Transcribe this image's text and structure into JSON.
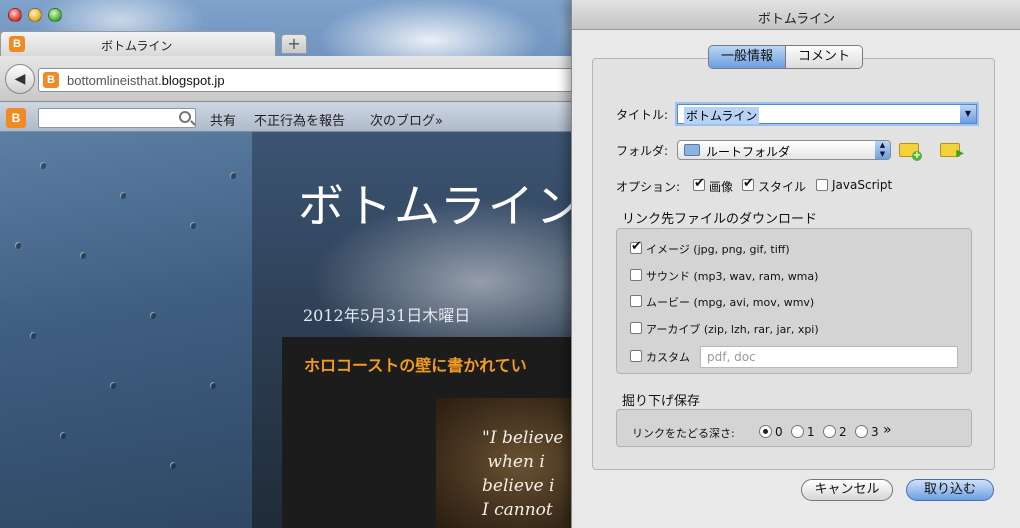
{
  "browser": {
    "tab_title": "ボトムライン",
    "new_tab_symbol": "+",
    "url_prefix": "bottomlineisthat.",
    "url_domain": "blogspot.jp",
    "blogger_letter": "B"
  },
  "blog_nav": {
    "share": "共有",
    "report": "不正行為を報告",
    "next_blog": "次のブログ»"
  },
  "blog": {
    "title": "ボトムライン",
    "date": "2012年5月31日木曜日",
    "post_title": "ホロコーストの壁に書かれてい",
    "quote": "\"I believe\n when i\nbelieve i\nI cannot"
  },
  "dialog": {
    "title": "ボトムライン",
    "tabs": [
      {
        "label": "一般情報",
        "active": true
      },
      {
        "label": "コメント",
        "active": false
      }
    ],
    "title_label": "タイトル:",
    "title_value": "ボトムライン",
    "folder_label": "フォルダ:",
    "folder_value": "ルートフォルダ",
    "options_label": "オプション:",
    "options": [
      {
        "label": "画像",
        "checked": true
      },
      {
        "label": "スタイル",
        "checked": true
      },
      {
        "label": "JavaScript",
        "checked": false
      }
    ],
    "download_heading": "リンク先ファイルのダウンロード",
    "download_types": [
      {
        "label": "イメージ (jpg, png, gif, tiff)",
        "checked": true
      },
      {
        "label": "サウンド (mp3, wav, ram, wma)",
        "checked": false
      },
      {
        "label": "ムービー (mpg, avi, mov, wmv)",
        "checked": false
      },
      {
        "label": "アーカイブ (zip, lzh, rar, jar, xpi)",
        "checked": false
      },
      {
        "label": "カスタム",
        "checked": false
      }
    ],
    "custom_placeholder": "pdf, doc",
    "deep_save_heading": "掘り下げ保存",
    "depth_label": "リンクをたどる深さ:",
    "depth_options": [
      "0",
      "1",
      "2",
      "3"
    ],
    "depth_selected": "0",
    "depth_more": "»",
    "cancel_label": "キャンセル",
    "import_label": "取り込む"
  },
  "colors": {
    "accent": "#6c9fe2",
    "blogger_orange": "#f08a24",
    "post_title": "#f29b21"
  },
  "icons": [
    "back-arrow-icon",
    "blogger-icon",
    "search-icon",
    "folder-icon",
    "new-folder-icon",
    "move-folder-icon",
    "popup-arrows-icon"
  ]
}
